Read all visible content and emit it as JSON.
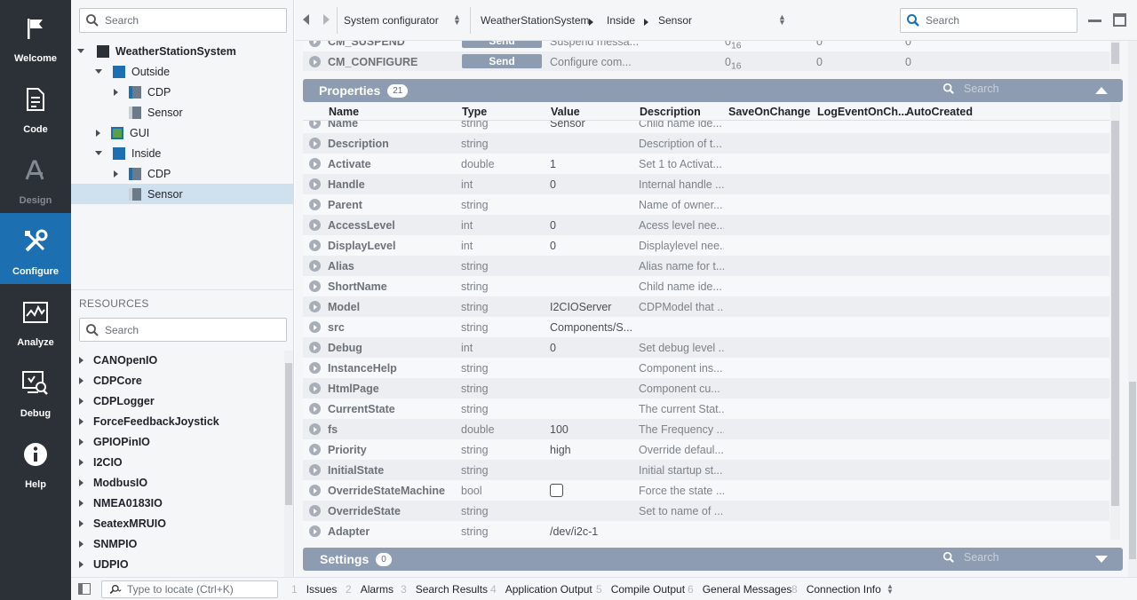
{
  "nav": [
    {
      "label": "Welcome",
      "icon": "flag-icon"
    },
    {
      "label": "Code",
      "icon": "document-icon"
    },
    {
      "label": "Design",
      "icon": "design-icon"
    },
    {
      "label": "Configure",
      "icon": "tools-icon"
    },
    {
      "label": "Analyze",
      "icon": "chart-icon"
    },
    {
      "label": "Debug",
      "icon": "debug-icon"
    },
    {
      "label": "Help",
      "icon": "info-icon"
    }
  ],
  "tree": {
    "search_placeholder": "Search",
    "items": [
      {
        "label": "WeatherStationSystem"
      },
      {
        "label": "Outside"
      },
      {
        "label": "CDP"
      },
      {
        "label": "Sensor"
      },
      {
        "label": "GUI"
      },
      {
        "label": "Inside"
      },
      {
        "label": "CDP"
      },
      {
        "label": "Sensor"
      }
    ]
  },
  "resources": {
    "header": "RESOURCES",
    "search_placeholder": "Search",
    "items": [
      "CANOpenIO",
      "CDPCore",
      "CDPLogger",
      "ForceFeedbackJoystick",
      "GPIOPinIO",
      "I2CIO",
      "ModbusIO",
      "NMEA0183IO",
      "SeatexMRUIO",
      "SNMPIO",
      "UDPIO"
    ]
  },
  "topbar": {
    "selector": "System configurator",
    "breadcrumb": [
      "WeatherStationSystem",
      "Inside",
      "Sensor"
    ],
    "search_placeholder": "Search"
  },
  "commands": [
    {
      "name": "CM_SUSPEND",
      "button": "Send",
      "desc": "Suspend messa...",
      "v1": "0",
      "v1sub": "16",
      "v2": "0",
      "v3": "0"
    },
    {
      "name": "CM_CONFIGURE",
      "button": "Send",
      "desc": "Configure com...",
      "v1": "0",
      "v1sub": "16",
      "v2": "0",
      "v3": "0"
    }
  ],
  "properties": {
    "title": "Properties",
    "count": "21",
    "search_placeholder": "Search",
    "columns": [
      "Name",
      "Type",
      "Value",
      "Description",
      "SaveOnChange",
      "LogEventOnCh...",
      "AutoCreated"
    ],
    "rows": [
      {
        "name": "Name",
        "type": "string",
        "value": "Sensor",
        "desc": "Child name ide..."
      },
      {
        "name": "Description",
        "type": "string",
        "value": "",
        "desc": "Description of t..."
      },
      {
        "name": "Activate",
        "type": "double",
        "value": "1",
        "desc": "Set 1 to Activat..."
      },
      {
        "name": "Handle",
        "type": "int",
        "value": "0",
        "desc": "Internal handle ..."
      },
      {
        "name": "Parent",
        "type": "string",
        "value": "",
        "desc": "Name of owner..."
      },
      {
        "name": "AccessLevel",
        "type": "int",
        "value": "0",
        "desc": "Acess level nee..."
      },
      {
        "name": "DisplayLevel",
        "type": "int",
        "value": "0",
        "desc": "Displaylevel nee..."
      },
      {
        "name": "Alias",
        "type": "string",
        "value": "",
        "desc": "Alias name for t..."
      },
      {
        "name": "ShortName",
        "type": "string",
        "value": "",
        "desc": "Child name ide..."
      },
      {
        "name": "Model",
        "type": "string",
        "value": "I2CIOServer",
        "desc": "CDPModel that ..."
      },
      {
        "name": "src",
        "type": "string",
        "value": "Components/S...",
        "desc": ""
      },
      {
        "name": "Debug",
        "type": "int",
        "value": "0",
        "desc": "Set debug level ..."
      },
      {
        "name": "InstanceHelp",
        "type": "string",
        "value": "",
        "desc": "Component ins..."
      },
      {
        "name": "HtmlPage",
        "type": "string",
        "value": "",
        "desc": "Component cu..."
      },
      {
        "name": "CurrentState",
        "type": "string",
        "value": "",
        "desc": "The current Stat..."
      },
      {
        "name": "fs",
        "type": "double",
        "value": "100",
        "desc": "The Frequency ..."
      },
      {
        "name": "Priority",
        "type": "string",
        "value": "high",
        "desc": "Override defaul..."
      },
      {
        "name": "InitialState",
        "type": "string",
        "value": "",
        "desc": "Initial startup st..."
      },
      {
        "name": "OverrideStateMachine",
        "type": "bool",
        "value": "",
        "desc": "Force the state ..."
      },
      {
        "name": "OverrideState",
        "type": "string",
        "value": "",
        "desc": "Set to name of ..."
      },
      {
        "name": "Adapter",
        "type": "string",
        "value": "/dev/i2c-1",
        "desc": ""
      }
    ]
  },
  "settings": {
    "title": "Settings",
    "count": "0",
    "search_placeholder": "Search"
  },
  "bottom": {
    "locate_placeholder": "Type to locate (Ctrl+K)",
    "tabs": [
      {
        "num": "1",
        "label": "Issues"
      },
      {
        "num": "2",
        "label": "Alarms"
      },
      {
        "num": "3",
        "label": "Search Results"
      },
      {
        "num": "4",
        "label": "Application Output"
      },
      {
        "num": "5",
        "label": "Compile Output"
      },
      {
        "num": "6",
        "label": "General Messages"
      },
      {
        "num": "8",
        "label": "Connection Info"
      }
    ]
  },
  "colors": {
    "accent": "#1c6fb1",
    "nav_bg": "#2b3137",
    "section_header": "#8d9cb0"
  }
}
